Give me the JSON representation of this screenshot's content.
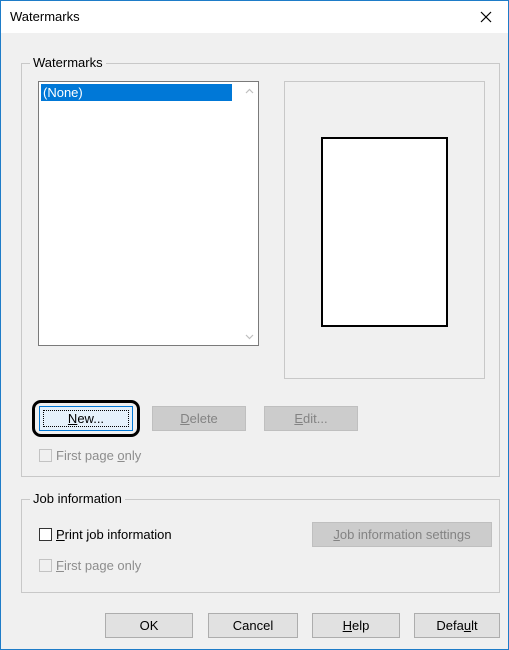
{
  "window": {
    "title": "Watermarks"
  },
  "watermarks_group": {
    "label": "Watermarks",
    "list": {
      "items": [
        "(None)"
      ],
      "selected": "(None)"
    },
    "buttons": {
      "new": {
        "pre": "",
        "mnemonic": "N",
        "post": "ew..."
      },
      "delete": {
        "pre": "",
        "mnemonic": "D",
        "post": "elete"
      },
      "edit": {
        "pre": "",
        "mnemonic": "E",
        "post": "dit..."
      }
    },
    "first_page_only": {
      "pre": "First page ",
      "mnemonic": "o",
      "post": "nly",
      "checked": false
    }
  },
  "job_info_group": {
    "label": "Job information",
    "print_job_info": {
      "pre": "",
      "mnemonic": "P",
      "post": "rint job information",
      "checked": false
    },
    "settings_button": {
      "pre": "",
      "mnemonic": "J",
      "post": "ob information settings"
    },
    "first_page_only": {
      "pre": "",
      "mnemonic": "F",
      "post": "irst page only",
      "checked": false
    }
  },
  "footer": {
    "ok": "OK",
    "cancel": "Cancel",
    "help": {
      "pre": "",
      "mnemonic": "H",
      "post": "elp"
    },
    "default": {
      "pre": "Defa",
      "mnemonic": "u",
      "post": "lt"
    }
  },
  "colors": {
    "selection": "#0078d7",
    "window_border": "#1e7cc8",
    "dialog_bg": "#f0f0f0"
  }
}
